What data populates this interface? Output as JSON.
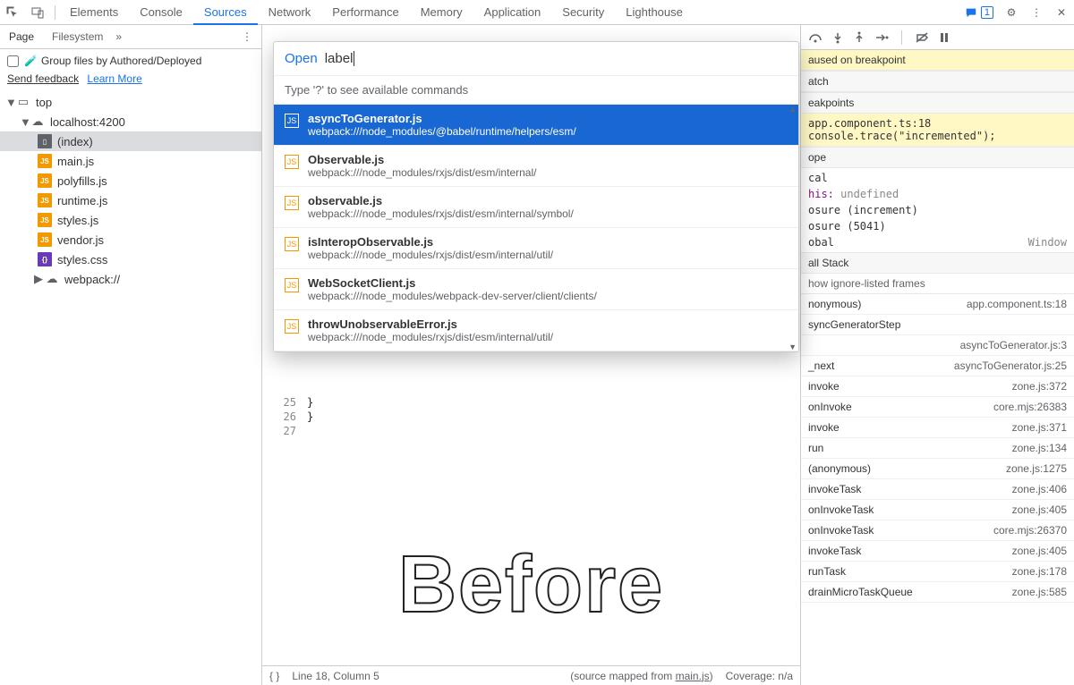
{
  "tabs": [
    "Elements",
    "Console",
    "Sources",
    "Network",
    "Performance",
    "Memory",
    "Application",
    "Security",
    "Lighthouse"
  ],
  "active_tab": "Sources",
  "feedback_count": "1",
  "left": {
    "subtabs": [
      "Page",
      "Filesystem"
    ],
    "group_files": "Group files by Authored/Deployed",
    "send_feedback": "Send feedback",
    "learn_more": "Learn More",
    "tree": {
      "top": "top",
      "host": "localhost:4200",
      "files": [
        "(index)",
        "main.js",
        "polyfills.js",
        "runtime.js",
        "styles.js",
        "vendor.js",
        "styles.css"
      ],
      "webpack": "webpack://"
    }
  },
  "palette": {
    "open": "Open",
    "query": "label",
    "hint": "Type '?' to see available commands",
    "results": [
      {
        "title": "asyncToGenerator.js",
        "path": "webpack:///node_modules/@babel/runtime/helpers/esm/"
      },
      {
        "title": "Observable.js",
        "path": "webpack:///node_modules/rxjs/dist/esm/internal/"
      },
      {
        "title": "observable.js",
        "path": "webpack:///node_modules/rxjs/dist/esm/internal/symbol/"
      },
      {
        "title": "isInteropObservable.js",
        "path": "webpack:///node_modules/rxjs/dist/esm/internal/util/"
      },
      {
        "title": "WebSocketClient.js",
        "path": "webpack:///node_modules/webpack-dev-server/client/clients/"
      },
      {
        "title": "throwUnobservableError.js",
        "path": "webpack:///node_modules/rxjs/dist/esm/internal/util/"
      }
    ]
  },
  "code": {
    "lines": [
      "25",
      "26",
      "27"
    ],
    "l25": "  }",
    "l26": "}",
    "l27": ""
  },
  "watermark": "Before",
  "statusbar": {
    "pos": "Line 18, Column 5",
    "mapped_prefix": "(source mapped from ",
    "mapped_file": "main.js",
    "mapped_suffix": ")",
    "coverage": "Coverage: n/a"
  },
  "right": {
    "paused": "aused on breakpoint",
    "watch": "atch",
    "breakpoints": "eakpoints",
    "bp_file": "app.component.ts:18",
    "bp_code": "console.trace(\"incremented\");",
    "scope": "ope",
    "local": "cal",
    "this_k": "his:",
    "this_v": "undefined",
    "closure1": "osure (increment)",
    "closure2": "osure (5041)",
    "global_k": "obal",
    "global_v": "Window",
    "callstack": "all Stack",
    "ignore": "how ignore-listed frames",
    "stack": [
      {
        "fn": "nonymous)",
        "loc": "app.component.ts:18"
      },
      {
        "fn": "syncGeneratorStep",
        "loc": ""
      },
      {
        "fn": "",
        "loc": "asyncToGenerator.js:3"
      },
      {
        "fn": "_next",
        "loc": "asyncToGenerator.js:25"
      },
      {
        "fn": "invoke",
        "loc": "zone.js:372"
      },
      {
        "fn": "onInvoke",
        "loc": "core.mjs:26383"
      },
      {
        "fn": "invoke",
        "loc": "zone.js:371"
      },
      {
        "fn": "run",
        "loc": "zone.js:134"
      },
      {
        "fn": "(anonymous)",
        "loc": "zone.js:1275"
      },
      {
        "fn": "invokeTask",
        "loc": "zone.js:406"
      },
      {
        "fn": "onInvokeTask",
        "loc": "zone.js:405"
      },
      {
        "fn": "onInvokeTask",
        "loc": "core.mjs:26370"
      },
      {
        "fn": "invokeTask",
        "loc": "zone.js:405"
      },
      {
        "fn": "runTask",
        "loc": "zone.js:178"
      },
      {
        "fn": "drainMicroTaskQueue",
        "loc": "zone.js:585"
      }
    ]
  }
}
